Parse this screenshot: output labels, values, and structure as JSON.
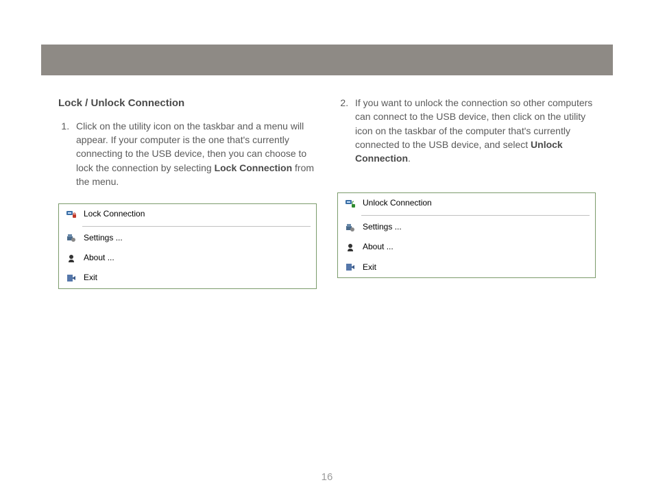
{
  "heading": "Lock / Unlock Connection",
  "step1": {
    "num": "1.",
    "text_before": "Click on the utility icon on the taskbar and a menu will appear.  If your computer is the one that's currently connecting to the USB device, then you can choose to lock the connection by selecting ",
    "bold": "Lock Connection",
    "text_after": " from the menu."
  },
  "step2": {
    "num": "2.",
    "text_before": "If you want to unlock the connection so other computers can connect to the USB device, then click on the utility icon on the taskbar of the computer that's currently connected to the USB device, and select ",
    "bold": "Unlock Connection",
    "text_after": "."
  },
  "menu_left": {
    "item1": "Lock Connection",
    "item2": "Settings ...",
    "item3": "About ...",
    "item4": "Exit"
  },
  "menu_right": {
    "item1": "Unlock Connection",
    "item2": "Settings ...",
    "item3": "About ...",
    "item4": "Exit"
  },
  "page_number": "16"
}
